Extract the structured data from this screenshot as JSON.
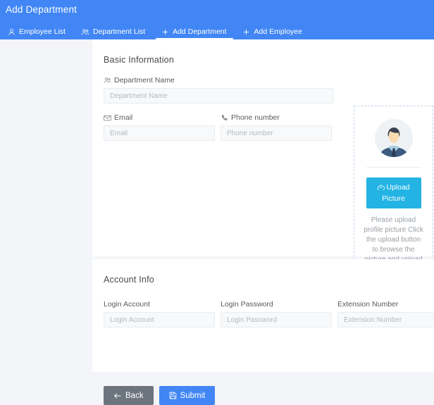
{
  "header": {
    "title": "Add Department",
    "bg_color": "#4186f4",
    "tabs": [
      {
        "label": "Employee List",
        "icon": "user-icon",
        "active": false
      },
      {
        "label": "Department List",
        "icon": "users-icon",
        "active": false
      },
      {
        "label": "Add Department",
        "icon": "plus-icon",
        "active": true
      },
      {
        "label": "Add Employee",
        "icon": "plus-icon",
        "active": false
      }
    ]
  },
  "basic_information": {
    "section_title": "Basic Information",
    "fields": [
      {
        "label": "Department Name",
        "icon": "users-icon",
        "placeholder": "Department Name",
        "value": ""
      },
      {
        "label": "Email",
        "icon": "envelope-icon",
        "placeholder": "Email",
        "value": ""
      },
      {
        "label": "Phone number",
        "icon": "phone-icon",
        "placeholder": "Phone number",
        "value": ""
      }
    ]
  },
  "upload_panel": {
    "button_label": "Upload Picture",
    "button_icon": "cloud-upload-icon",
    "button_color": "#23b4e3",
    "avatar_icon": "avatar-placeholder-icon",
    "hint": "Please upload profile picture Click the upload button to browse the picture and upload"
  },
  "account_info": {
    "section_title": "Account Info",
    "fields": [
      {
        "label": "Login Account",
        "placeholder": "Login Account",
        "value": ""
      },
      {
        "label": "Login Password",
        "placeholder": "Login Password",
        "value": ""
      },
      {
        "label": "Extension Number",
        "placeholder": "Extension Number",
        "value": ""
      }
    ]
  },
  "footer": {
    "back_label": "Back",
    "back_icon": "arrow-left-icon",
    "back_color": "#6c757d",
    "submit_label": "Submit",
    "submit_icon": "save-icon",
    "submit_color": "#4186f4"
  }
}
